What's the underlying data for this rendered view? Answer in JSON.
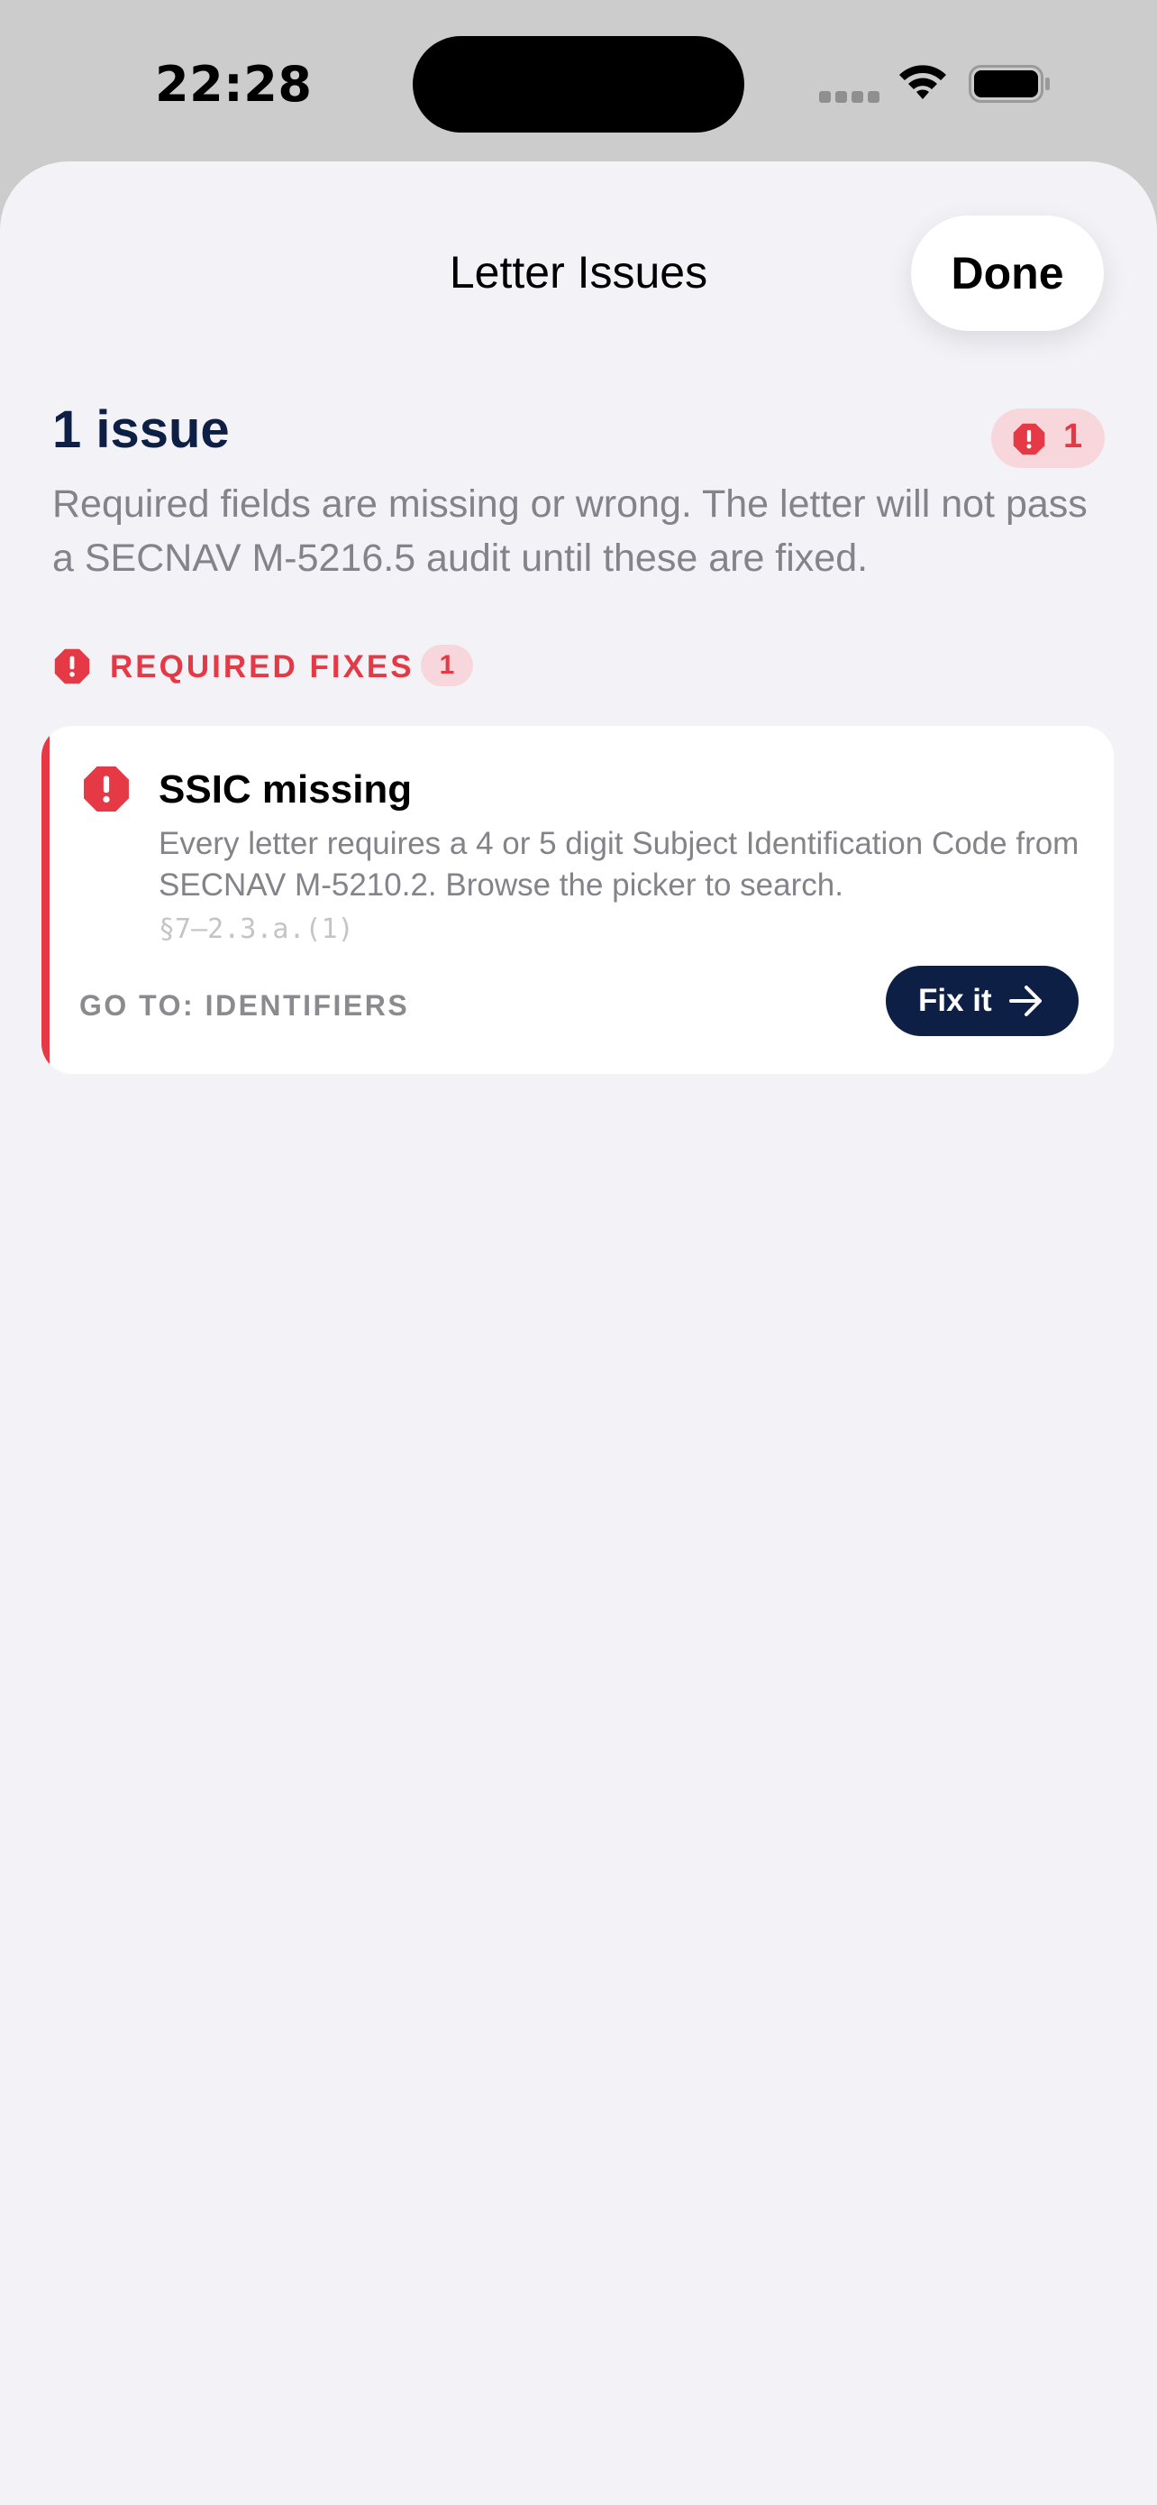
{
  "status_bar": {
    "time": "22:28"
  },
  "sheet": {
    "title": "Letter Issues",
    "done_label": "Done"
  },
  "summary": {
    "heading": "1 issue",
    "count": "1",
    "description": "Required fields are missing or wrong. The letter will not pass a SECNAV M-5216.5 audit until these are fixed."
  },
  "section": {
    "label": "REQUIRED FIXES",
    "count": "1"
  },
  "issues": [
    {
      "title": "SSIC missing",
      "description": "Every letter requires a 4 or 5 digit Subject Identification Code from SECNAV M-5210.2. Browse the picker to search.",
      "reference": "§7–2.3.a.(1)",
      "goto_label": "GO TO: IDENTIFIERS",
      "fix_label": "Fix it"
    }
  ],
  "icons": {
    "signal": "cellular-signal-icon",
    "wifi": "wifi-icon",
    "battery": "battery-icon",
    "alert": "exclamation-octagon-icon",
    "arrow": "arrow-right-icon"
  },
  "colors": {
    "error": "#e53945",
    "error_tint": "#f8d7dc",
    "navy": "#0d1f45",
    "background": "#f2f2f7",
    "secondary_text": "#84838a"
  }
}
